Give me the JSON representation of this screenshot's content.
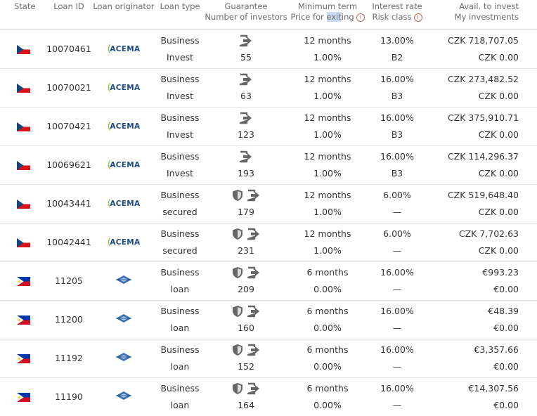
{
  "headers": {
    "state": "State",
    "loan_id": "Loan ID",
    "originator": "Loan originator",
    "loan_type": "Loan type",
    "guarantee": "Guarantee",
    "investors": "Number of investors",
    "min_term": "Minimum term",
    "exit_price_prefix": "Price for ",
    "exit_price_hl": "exit",
    "exit_price_suffix": "ing",
    "interest": "Interest rate",
    "risk": "Risk class",
    "avail": "Avail. to invest",
    "my_inv": "My investments",
    "info_glyph": "i"
  },
  "acema_logo_text": "ACEMA",
  "rows": [
    {
      "flag": "cz",
      "id": "10070461",
      "orig": "acema",
      "type1": "Business",
      "type2": "Invest",
      "shield": false,
      "investors": "55",
      "term": "12 months",
      "exit": "1.00%",
      "rate": "13.00%",
      "risk": "B2",
      "avail": "CZK 718,707.05",
      "mine": "CZK 0.00"
    },
    {
      "flag": "cz",
      "id": "10070021",
      "orig": "acema",
      "type1": "Business",
      "type2": "Invest",
      "shield": false,
      "investors": "63",
      "term": "12 months",
      "exit": "1.00%",
      "rate": "16.00%",
      "risk": "B3",
      "avail": "CZK 273,482.52",
      "mine": "CZK 0.00"
    },
    {
      "flag": "cz",
      "id": "10070421",
      "orig": "acema",
      "type1": "Business",
      "type2": "Invest",
      "shield": false,
      "investors": "123",
      "term": "12 months",
      "exit": "1.00%",
      "rate": "16.00%",
      "risk": "B3",
      "avail": "CZK 375,910.71",
      "mine": "CZK 0.00"
    },
    {
      "flag": "cz",
      "id": "10069621",
      "orig": "acema",
      "type1": "Business",
      "type2": "Invest",
      "shield": false,
      "investors": "193",
      "term": "12 months",
      "exit": "1.00%",
      "rate": "16.00%",
      "risk": "B3",
      "avail": "CZK 114,296.37",
      "mine": "CZK 0.00"
    },
    {
      "flag": "cz",
      "id": "10043441",
      "orig": "acema",
      "type1": "Business",
      "type2": "secured",
      "shield": true,
      "investors": "179",
      "term": "12 months",
      "exit": "1.00%",
      "rate": "6.00%",
      "risk": "—",
      "avail": "CZK 519,648.40",
      "mine": "CZK 0.00"
    },
    {
      "flag": "cz",
      "id": "10042441",
      "orig": "acema",
      "type1": "Business",
      "type2": "secured",
      "shield": true,
      "investors": "231",
      "term": "12 months",
      "exit": "1.00%",
      "rate": "6.00%",
      "risk": "—",
      "avail": "CZK 7,702.63",
      "mine": "CZK 0.00"
    },
    {
      "flag": "ph",
      "id": "11205",
      "orig": "diamond",
      "type1": "Business",
      "type2": "loan",
      "shield": true,
      "investors": "209",
      "term": "6 months",
      "exit": "0.00%",
      "rate": "16.00%",
      "risk": "—",
      "avail": "€993.23",
      "mine": "€0.00"
    },
    {
      "flag": "ph",
      "id": "11200",
      "orig": "diamond",
      "type1": "Business",
      "type2": "loan",
      "shield": true,
      "investors": "160",
      "term": "6 months",
      "exit": "0.00%",
      "rate": "16.00%",
      "risk": "—",
      "avail": "€48.39",
      "mine": "€0.00"
    },
    {
      "flag": "ph",
      "id": "11192",
      "orig": "diamond",
      "type1": "Business",
      "type2": "loan",
      "shield": true,
      "investors": "152",
      "term": "6 months",
      "exit": "0.00%",
      "rate": "16.00%",
      "risk": "—",
      "avail": "€3,357.66",
      "mine": "€0.00"
    },
    {
      "flag": "ph",
      "id": "11190",
      "orig": "diamond",
      "type1": "Business",
      "type2": "loan",
      "shield": true,
      "investors": "164",
      "term": "6 months",
      "exit": "0.00%",
      "rate": "16.00%",
      "risk": "—",
      "avail": "€14,307.56",
      "mine": "€0.00"
    }
  ],
  "colors": {
    "cz_blue": "#11457e",
    "cz_red": "#d7141a",
    "ph_blue": "#0038a8",
    "ph_red": "#ce1126",
    "ph_yellow": "#fcd116",
    "icon_gray": "#666666"
  }
}
